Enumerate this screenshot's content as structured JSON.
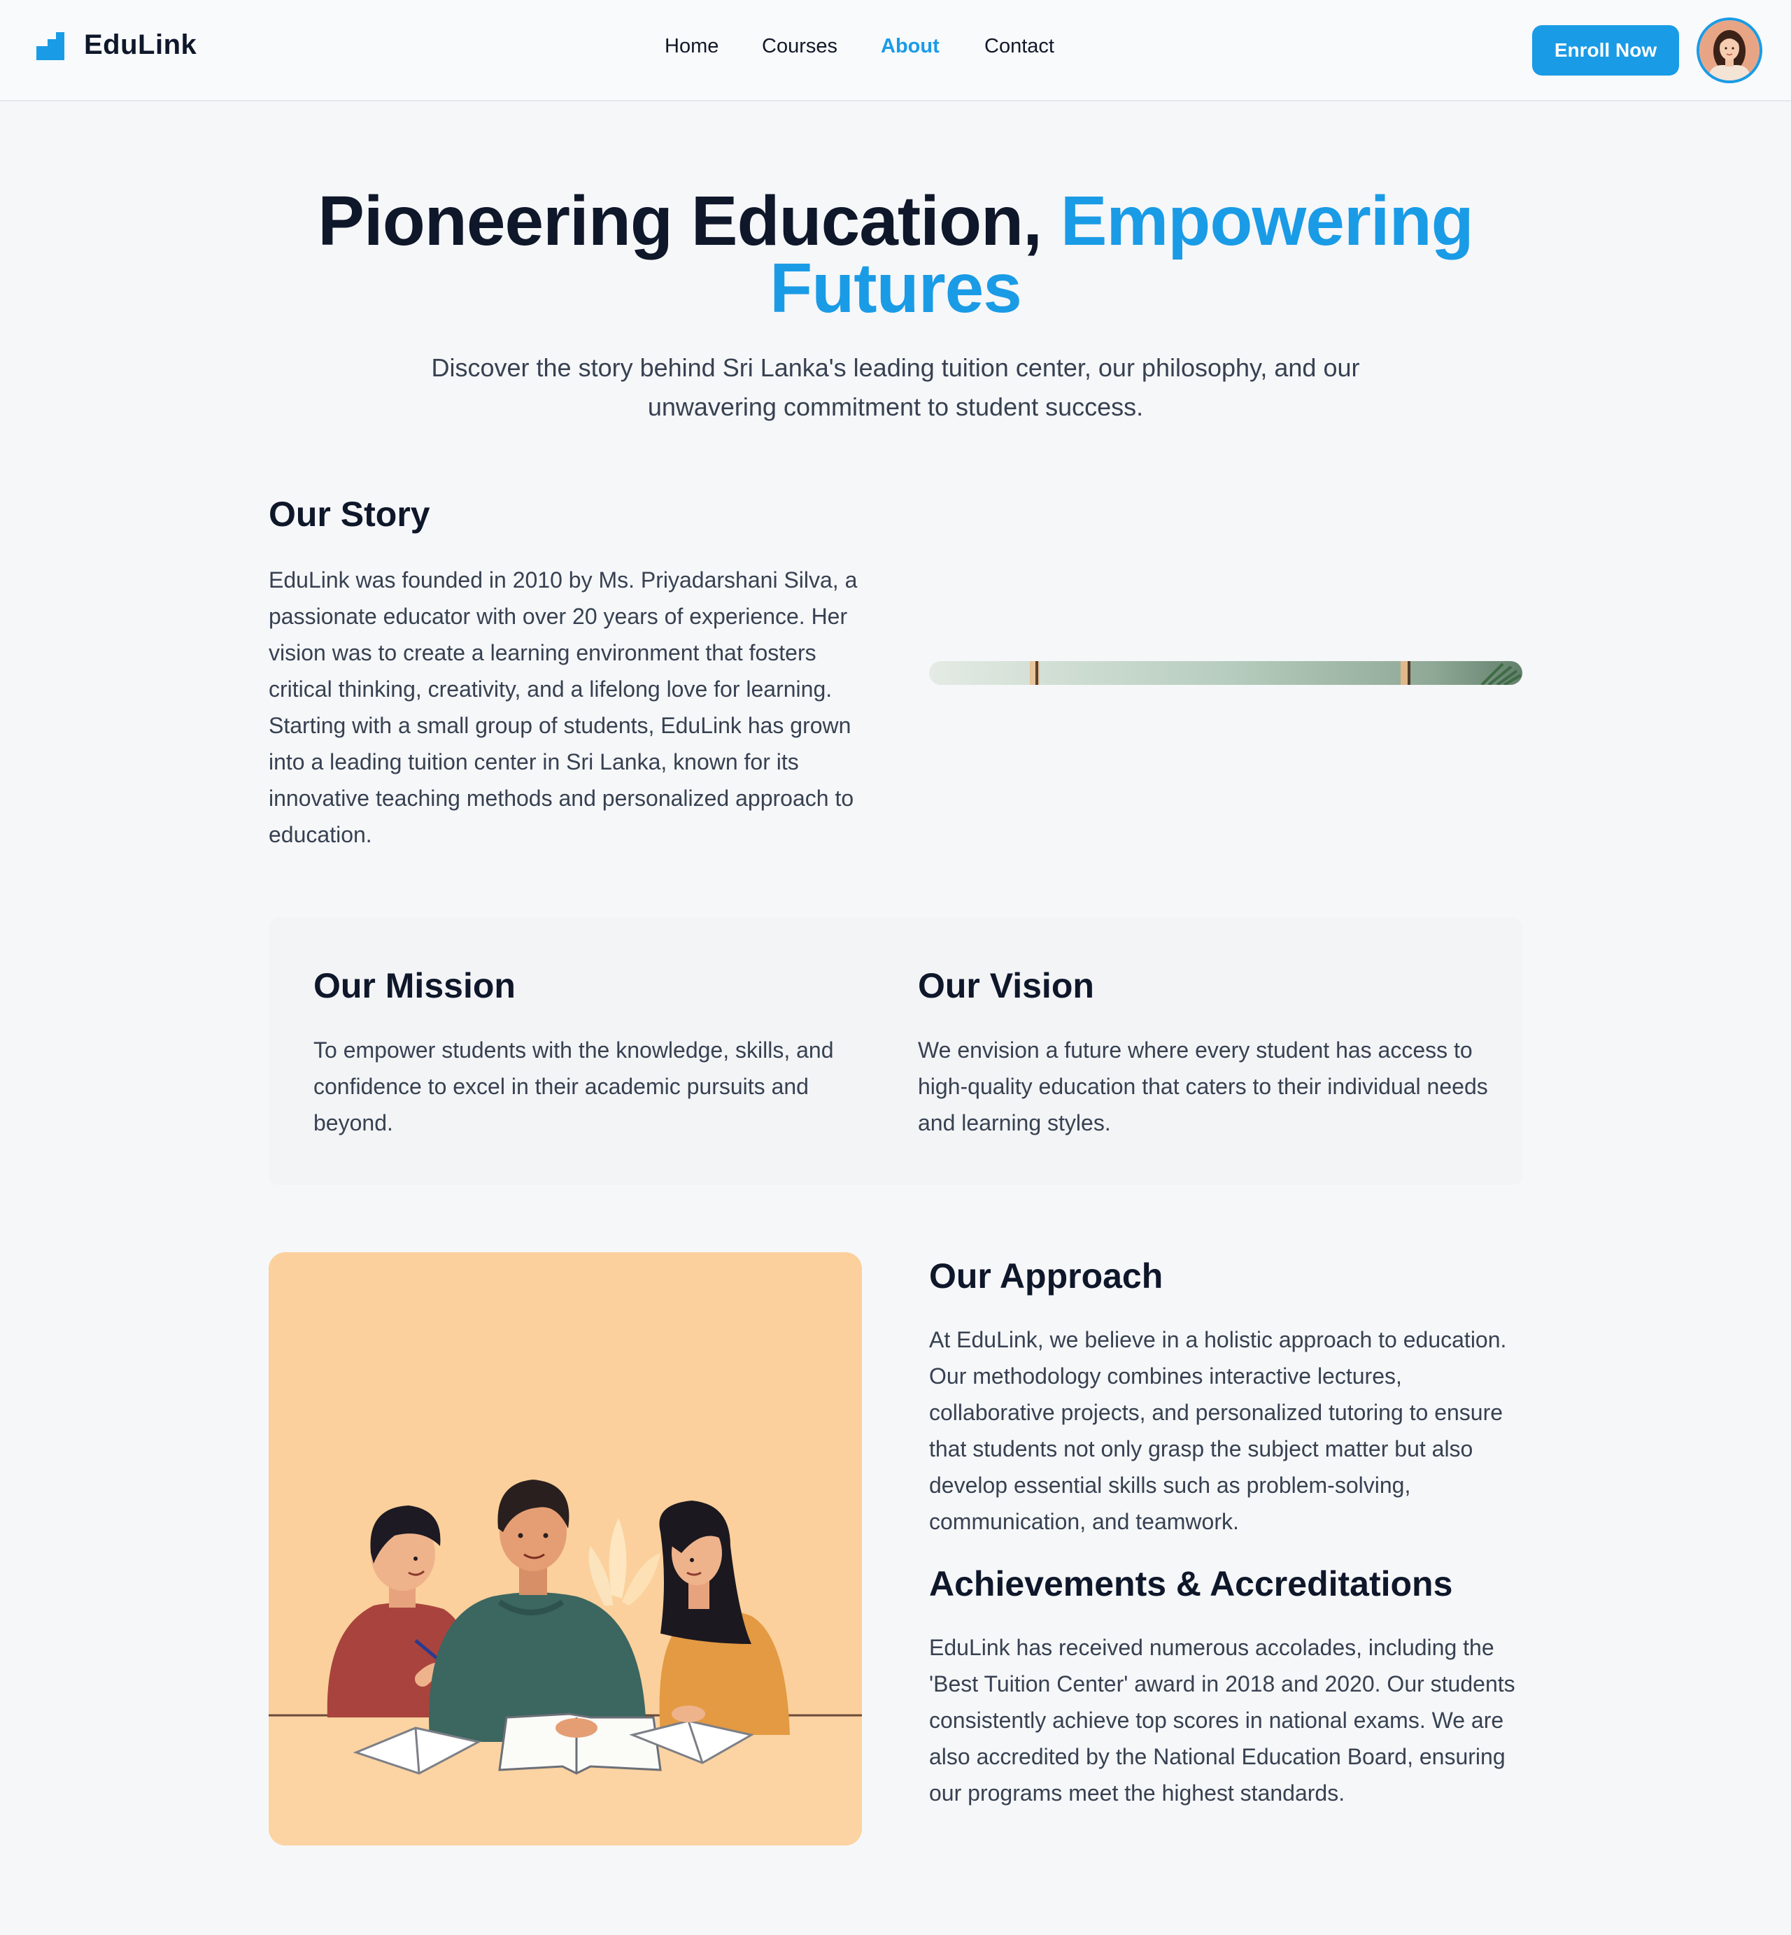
{
  "header": {
    "logo_text": "EduLink",
    "nav": [
      {
        "label": "Home",
        "active": false
      },
      {
        "label": "Courses",
        "active": false
      },
      {
        "label": "About",
        "active": true
      },
      {
        "label": "Contact",
        "active": false
      }
    ],
    "enroll_label": "Enroll Now"
  },
  "hero": {
    "title_main": "Pioneering Education, ",
    "title_accent": "Empowering Futures",
    "subtitle": "Discover the story behind Sri Lanka's leading tuition center, our philosophy, and our unwavering commitment to student success."
  },
  "story": {
    "title": "Our Story",
    "text": "EduLink was founded in 2010 by Ms. Priyadarshani Silva, a passionate educator with over 20 years of experience. Her vision was to create a learning environment that fosters critical thinking, creativity, and a lifelong love for learning. Starting with a small group of students, EduLink has grown into a leading tuition center in Sri Lanka, known for its innovative teaching methods and personalized approach to education."
  },
  "mission": {
    "title": "Our Mission",
    "text": "To empower students with the knowledge, skills, and confidence to excel in their academic pursuits and beyond."
  },
  "vision": {
    "title": "Our Vision",
    "text": "We envision a future where every student has access to high-quality education that caters to their individual needs and learning styles."
  },
  "approach": {
    "title": "Our Approach",
    "text": "At EduLink, we believe in a holistic approach to education. Our methodology combines interactive lectures, collaborative projects, and personalized tutoring to ensure that students not only grasp the subject matter but also develop essential skills such as problem-solving, communication, and teamwork."
  },
  "achievements": {
    "title": "Achievements & Accreditations",
    "text": "EduLink has received numerous accolades, including the 'Best Tuition Center' award in 2018 and 2020. Our students consistently achieve top scores in national exams. We are also accredited by the National Education Board, ensuring our programs meet the highest standards."
  },
  "colors": {
    "accent": "#1a9be6",
    "heading": "#0f172a",
    "body_text": "#374151",
    "background": "#f6f7f9",
    "illustration_bg": "#fbd09c"
  },
  "icons": {
    "logo": "stairs-logo-icon",
    "avatar": "user-avatar"
  }
}
